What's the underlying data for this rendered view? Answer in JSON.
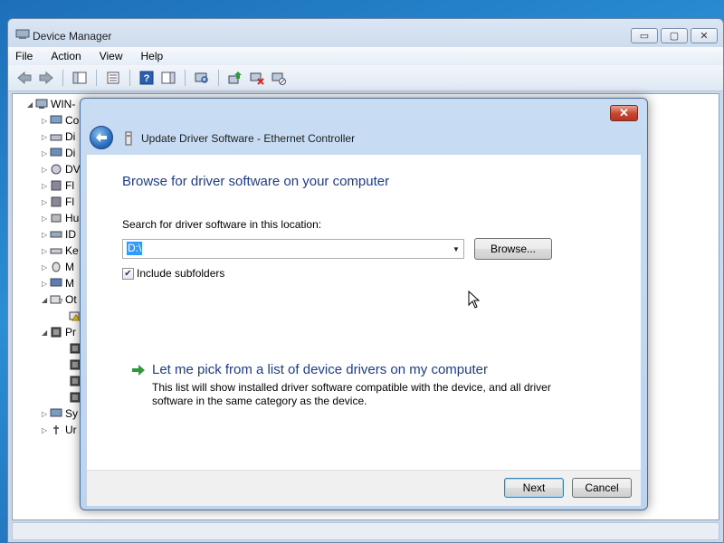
{
  "window": {
    "title": "Device Manager",
    "caption_buttons": {
      "minimize": "▭",
      "maximize": "▢",
      "close": "✕"
    }
  },
  "menu": {
    "items": [
      "File",
      "Action",
      "View",
      "Help"
    ]
  },
  "toolbar": {
    "icons": [
      "back-icon",
      "forward-icon",
      "show-hide-console-tree-icon",
      "properties-icon",
      "help-icon",
      "action-pane-icon",
      "scan-hardware-icon",
      "update-driver-icon",
      "uninstall-icon",
      "disable-icon"
    ]
  },
  "tree": {
    "root": "WIN-",
    "nodes": [
      "Co",
      "Di",
      "Di",
      "DV",
      "Fl",
      "Fl",
      "Hu",
      "ID",
      "Ke",
      "M",
      "M",
      "Ot",
      "",
      "Pr",
      "",
      "",
      "",
      "",
      "Sy",
      "Ur"
    ]
  },
  "dialog": {
    "title": "Update Driver Software - Ethernet Controller",
    "close_label": "✕",
    "heading": "Browse for driver software on your computer",
    "search_label": "Search for driver software in this location:",
    "search_value": "D:\\",
    "browse_label": "Browse...",
    "include_subfolders_label": "Include subfolders",
    "include_subfolders_checked": true,
    "check_mark": "✔",
    "pick_title": "Let me pick from a list of device drivers on my computer",
    "pick_description": "This list will show installed driver software compatible with the device, and all driver software in the same category as the device.",
    "next_label": "Next",
    "cancel_label": "Cancel"
  },
  "colors": {
    "heading_blue": "#1e3c8c",
    "selection_blue": "#3399ff",
    "link_arrow_green": "#2e9b3a"
  }
}
